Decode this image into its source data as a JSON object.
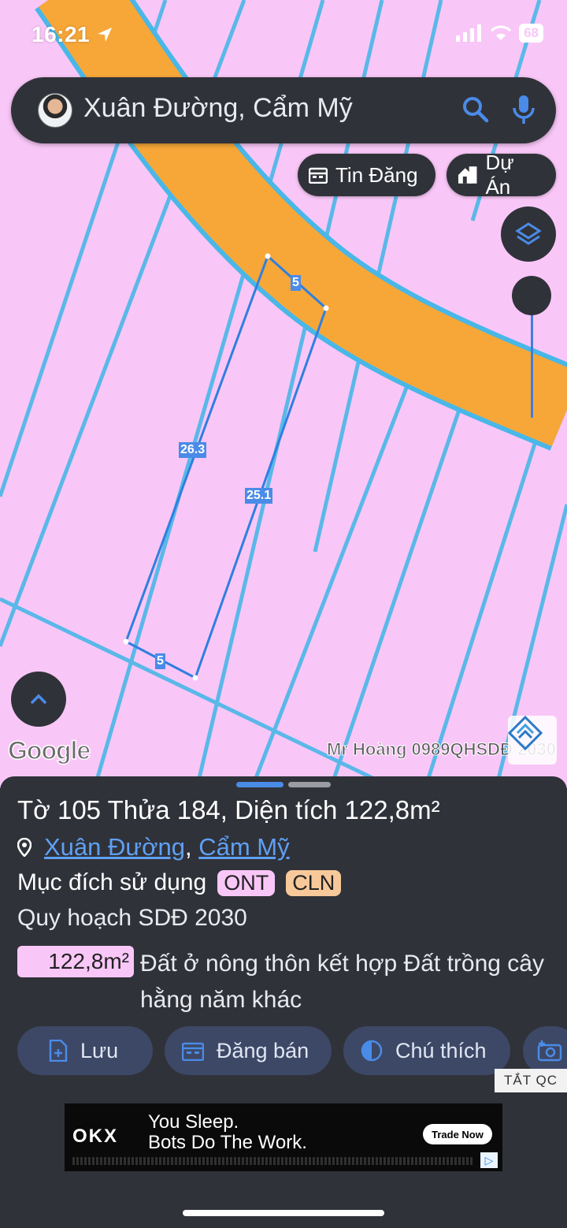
{
  "status_bar": {
    "time": "16:21",
    "battery": "68"
  },
  "search": {
    "query": "Xuân Đường, Cẩm Mỹ"
  },
  "chips": {
    "tin_dang": "Tin Đăng",
    "du_an": "Dự Án"
  },
  "map": {
    "edge_labels": {
      "top": "5",
      "left": "26.3",
      "right": "25.1",
      "bottom": "5"
    },
    "google_logo": "Google",
    "watermark": "Mr Hoàng 0989QHSDĐ 2030",
    "colors": {
      "land": "#f9c7f7",
      "road": "#f7a738",
      "parcel_line": "#3f7fd8"
    }
  },
  "sheet": {
    "title": "Tờ 105 Thửa 184, Diện tích 122,8m²",
    "location_ward": "Xuân Đường",
    "location_sep": ",",
    "location_district": "Cẩm Mỹ",
    "purpose_label": "Mục đích sử dụng",
    "tags": [
      "ONT",
      "CLN"
    ],
    "plan_label": "Quy hoạch SDĐ 2030",
    "area_value": "122,8m²",
    "area_description": "Đất ở nông thôn kết hợp Đất trồng cây hằng năm khác",
    "actions": {
      "luu": "Lưu",
      "dang_ban": "Đăng bán",
      "chu_thich": "Chú thích"
    }
  },
  "ad": {
    "close_label": "TẮT QC",
    "brand": "OKX",
    "line1": "You Sleep.",
    "line2": "Bots Do The Work.",
    "cta": "Trade Now"
  }
}
